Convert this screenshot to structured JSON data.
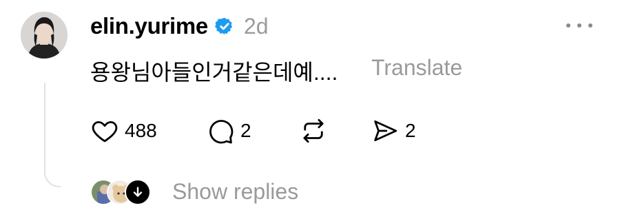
{
  "comment": {
    "username": "elin.yurime",
    "verified_icon": "verified-badge-icon",
    "time": "2d",
    "text": "용왕님아들인거같은데예....",
    "translate_label": "Translate"
  },
  "actions": {
    "likes": "488",
    "comments": "2",
    "shares": "2"
  },
  "replies": {
    "label": "Show replies"
  },
  "colors": {
    "verified": "#1d9bf0",
    "muted": "#9a9a9a",
    "text": "#000000"
  }
}
